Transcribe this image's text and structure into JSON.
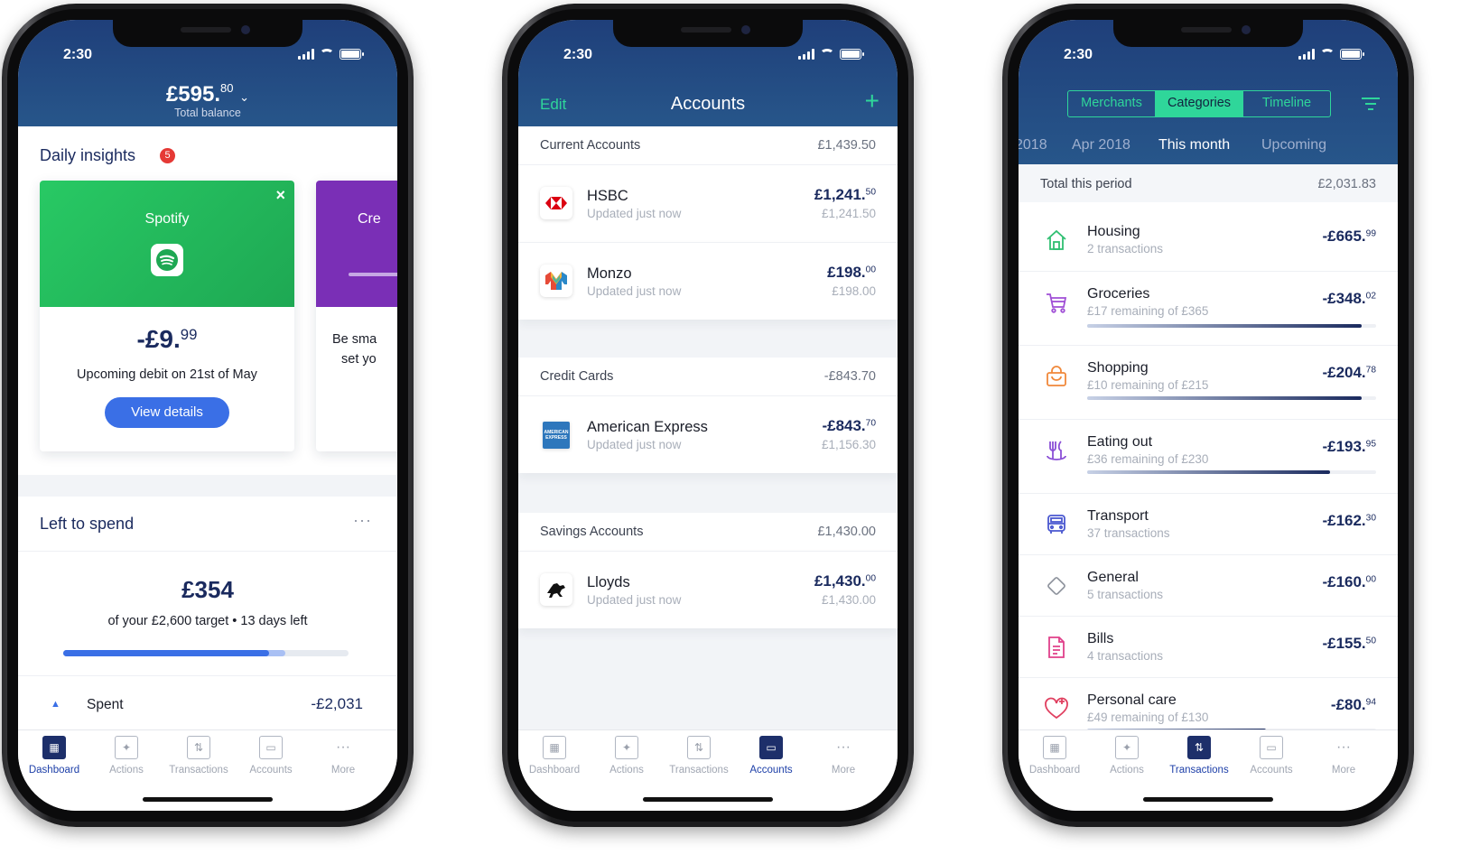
{
  "phones": [
    {
      "status_time": "2:30",
      "balance_main": "£595.",
      "balance_pence": "80",
      "balance_label": "Total balance",
      "insights_title": "Daily insights",
      "insights_count": "5",
      "insight_card": {
        "merchant": "Spotify",
        "amount_main": "-£9.",
        "amount_pence": "99",
        "description": "Upcoming debit on 21st of May",
        "button": "View details"
      },
      "peek_card": {
        "title": "Cre",
        "line1": "Be sma",
        "line2": "set yo"
      },
      "left_to_spend": {
        "title": "Left to spend",
        "amount": "£354",
        "subtitle": "of your £2,600 target • 13 days left",
        "progress": 0.72,
        "projected": 0.78
      },
      "spent_label": "Spent",
      "spent_value": "-£2,031",
      "active_tab": 0
    },
    {
      "status_time": "2:30",
      "edit_label": "Edit",
      "title": "Accounts",
      "add_label": "+",
      "sections": [
        {
          "name": "Current Accounts",
          "total": "£1,439.50",
          "rows": [
            {
              "name": "HSBC",
              "updated": "Updated just now",
              "main": "£1,241.",
              "pence": "50",
              "sub": "£1,241.50",
              "logo": "hsbc-logo-icon"
            },
            {
              "name": "Monzo",
              "updated": "Updated just now",
              "main": "£198.",
              "pence": "00",
              "sub": "£198.00",
              "logo": "monzo-logo-icon"
            }
          ]
        },
        {
          "name": "Credit Cards",
          "total": "-£843.70",
          "rows": [
            {
              "name": "American Express",
              "updated": "Updated just now",
              "main": "-£843.",
              "pence": "70",
              "sub": "£1,156.30",
              "logo": "amex-logo-icon"
            }
          ]
        },
        {
          "name": "Savings Accounts",
          "total": "£1,430.00",
          "rows": [
            {
              "name": "Lloyds",
              "updated": "Updated just now",
              "main": "£1,430.",
              "pence": "00",
              "sub": "£1,430.00",
              "logo": "lloyds-logo-icon"
            }
          ]
        }
      ],
      "active_tab": 3
    },
    {
      "status_time": "2:30",
      "segments": [
        "Merchants",
        "Categories",
        "Timeline"
      ],
      "active_segment": 1,
      "periods": [
        "2018",
        "Apr 2018",
        "This month",
        "Upcoming"
      ],
      "active_period": 2,
      "total_label": "Total this period",
      "total_value": "£2,031.83",
      "categories": [
        {
          "name": "Housing",
          "sub": "2 transactions",
          "main": "-£665.",
          "pence": "99",
          "icon": "house-icon",
          "color": "#2fbf71"
        },
        {
          "name": "Groceries",
          "sub": "£17 remaining of £365",
          "main": "-£348.",
          "pence": "02",
          "icon": "cart-icon",
          "color": "#a04fd6",
          "progress": 0.95
        },
        {
          "name": "Shopping",
          "sub": "£10 remaining of £215",
          "main": "-£204.",
          "pence": "78",
          "icon": "bag-icon",
          "color": "#f0883a",
          "progress": 0.95
        },
        {
          "name": "Eating out",
          "sub": "£36 remaining of £230",
          "main": "-£193.",
          "pence": "95",
          "icon": "cutlery-icon",
          "color": "#8a4fd6",
          "progress": 0.84
        },
        {
          "name": "Transport",
          "sub": "37 transactions",
          "main": "-£162.",
          "pence": "30",
          "icon": "bus-icon",
          "color": "#4a58d0"
        },
        {
          "name": "General",
          "sub": "5 transactions",
          "main": "-£160.",
          "pence": "00",
          "icon": "diamond-icon",
          "color": "#8a8f99"
        },
        {
          "name": "Bills",
          "sub": "4 transactions",
          "main": "-£155.",
          "pence": "50",
          "icon": "document-icon",
          "color": "#e0408a"
        },
        {
          "name": "Personal care",
          "sub": "£49 remaining of £130",
          "main": "-£80.",
          "pence": "94",
          "icon": "heart-icon",
          "color": "#e04060",
          "progress": 0.62
        }
      ],
      "active_tab": 2
    }
  ],
  "tabs": [
    "Dashboard",
    "Actions",
    "Transactions",
    "Accounts",
    "More"
  ],
  "colors": {
    "accent_green": "#2fd69a",
    "navy": "#1a2a5e",
    "blue_button": "#3a6fe6",
    "spotify_green": "#22c55e",
    "badge_red": "#e53935"
  }
}
